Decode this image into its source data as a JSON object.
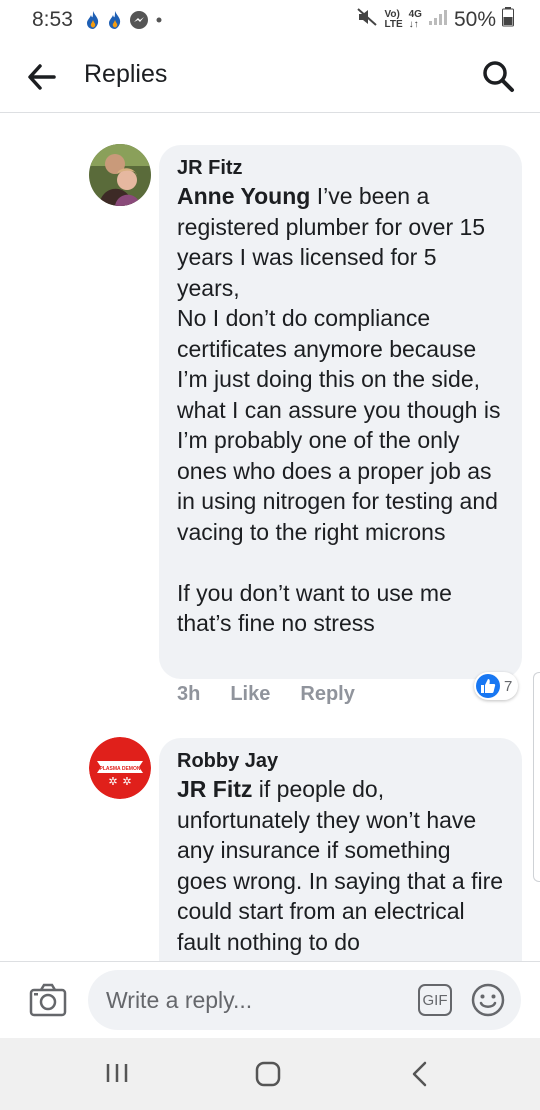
{
  "status_bar": {
    "time": "8:53",
    "network_top": "Vo)",
    "network_bottom": "LTE",
    "net_gen_top": "4G",
    "net_gen_bottom": "↓↑",
    "battery": "50%"
  },
  "header": {
    "title": "Replies"
  },
  "comments": [
    {
      "author": "JR Fitz",
      "mention": "Anne Young",
      "text": " I’ve been a registered plumber for over 15 years I was licensed for 5 years,\nNo I don’t do compliance certificates anymore because I’m just doing this on the side, what I can assure you though is I’m probably one of the only ones who does a proper job as in using nitrogen for testing and vacing to the right microns\n\nIf you don’t want to use me that’s fine no stress",
      "time": "3h",
      "like_label": "Like",
      "reply_label": "Reply",
      "reaction_count": "7"
    },
    {
      "author": "Robby Jay",
      "mention": "JR Fitz",
      "text": " if people do, unfortunately they won’t have any insurance if something goes wrong. In saying that a fire could start from an electrical fault nothing to do",
      "avatar_text": "PLASMA DEMON"
    }
  ],
  "composer": {
    "placeholder": "Write a reply...",
    "gif_label": "GIF"
  },
  "colors": {
    "accent": "#1877f2",
    "bubble": "#f0f2f5",
    "meta": "#90949c",
    "avatar_red": "#e0201b"
  }
}
